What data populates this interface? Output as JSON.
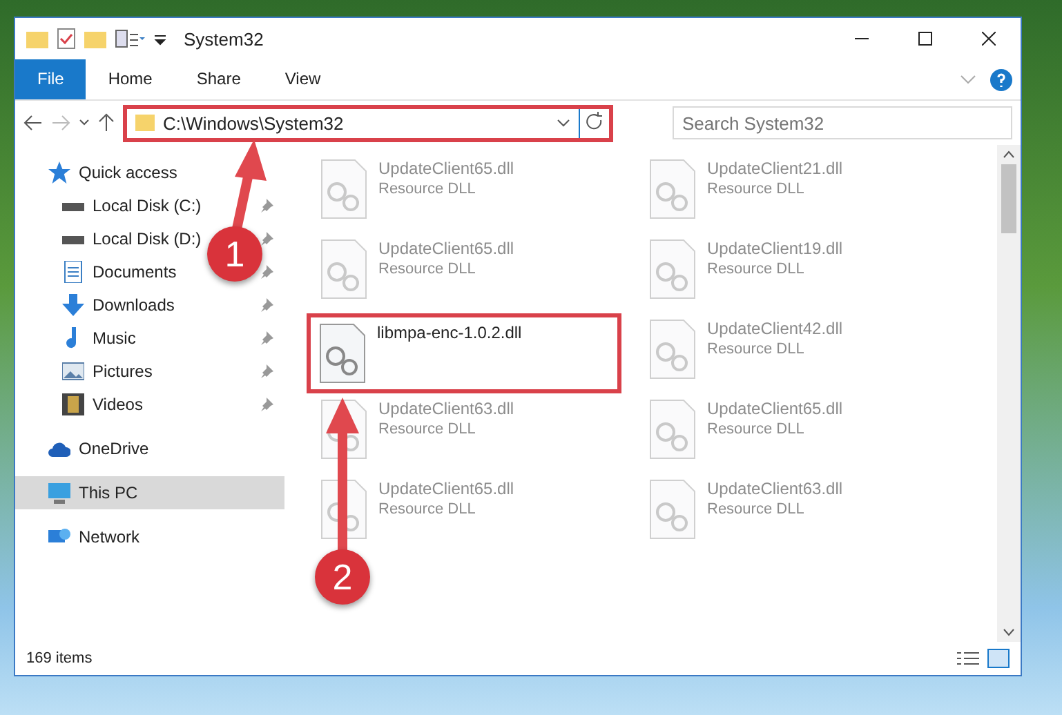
{
  "window": {
    "title": "System32"
  },
  "ribbon_tabs": [
    {
      "label": "File",
      "kind": "file",
      "selected": false
    },
    {
      "label": "Home",
      "kind": "tab",
      "selected": false
    },
    {
      "label": "Share",
      "kind": "tab",
      "selected": false
    },
    {
      "label": "View",
      "kind": "tab",
      "selected": false
    }
  ],
  "address": {
    "path": "C:\\Windows\\System32",
    "highlighted": true
  },
  "search": {
    "placeholder": "Search System32"
  },
  "navigation": [
    {
      "label": "Quick access",
      "selected": false,
      "children": [
        {
          "label": "Local Disk (C:)",
          "pinned": true,
          "selected": false
        },
        {
          "label": "Local Disk (D:)",
          "pinned": true,
          "selected": false
        },
        {
          "label": "Documents",
          "pinned": true,
          "selected": false
        },
        {
          "label": "Downloads",
          "pinned": true,
          "selected": false
        },
        {
          "label": "Music",
          "pinned": true,
          "selected": false
        },
        {
          "label": "Pictures",
          "pinned": true,
          "selected": false
        },
        {
          "label": "Videos",
          "pinned": true,
          "selected": false
        }
      ]
    },
    {
      "label": "OneDrive",
      "selected": false
    },
    {
      "label": "This PC",
      "selected": true
    },
    {
      "label": "Network",
      "selected": false
    }
  ],
  "files": [
    {
      "name": "UpdateClient65.dll",
      "type": "Resource DLL",
      "faded": true,
      "highlighted": false
    },
    {
      "name": "UpdateClient21.dll",
      "type": "Resource DLL",
      "faded": true,
      "highlighted": false
    },
    {
      "name": "UpdateClient65.dll",
      "type": "Resource DLL",
      "faded": true,
      "highlighted": false
    },
    {
      "name": "UpdateClient19.dll",
      "type": "Resource DLL",
      "faded": true,
      "highlighted": false
    },
    {
      "name": "libmpa-enc-1.0.2.dll",
      "faded": false,
      "highlighted": true
    },
    {
      "name": "UpdateClient42.dll",
      "type": "Resource DLL",
      "faded": true,
      "highlighted": false
    },
    {
      "name": "UpdateClient63.dll",
      "type": "Resource DLL",
      "faded": true,
      "highlighted": false
    },
    {
      "name": "UpdateClient65.dll",
      "type": "Resource DLL",
      "faded": true,
      "highlighted": false
    },
    {
      "name": "UpdateClient65.dll",
      "type": "Resource DLL",
      "faded": true,
      "highlighted": false
    },
    {
      "name": "UpdateClient63.dll",
      "type": "Resource DLL",
      "faded": true,
      "highlighted": false
    }
  ],
  "status_bar": {
    "item_count": "169 items"
  },
  "callouts": [
    {
      "number": "1"
    },
    {
      "number": "2"
    }
  ]
}
